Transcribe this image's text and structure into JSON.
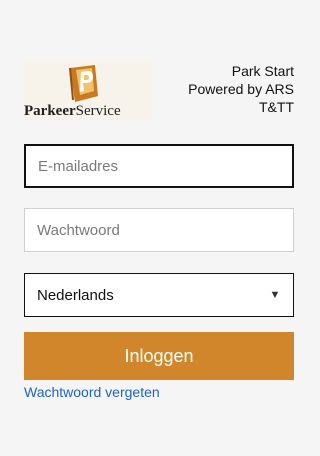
{
  "brand": {
    "name_part1": "Parkeer",
    "name_part2": "Service",
    "logo_icon": "parking-p-logo-icon",
    "accent_color": "#d2862b"
  },
  "app_info": {
    "line1": "Park Start",
    "line2": "Powered by ARS",
    "line3": "T&TT"
  },
  "form": {
    "email": {
      "placeholder": "E-mailadres",
      "value": ""
    },
    "password": {
      "placeholder": "Wachtwoord",
      "value": ""
    },
    "language": {
      "selected": "Nederlands",
      "chevron_icon": "chevron-down-icon"
    },
    "login_label": "Inloggen",
    "forgot_label": "Wachtwoord vergeten"
  }
}
